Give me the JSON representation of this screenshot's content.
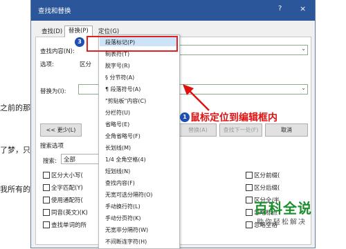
{
  "background_text": [
    "之前的那个",
    "了梦，只要",
    "我所有的"
  ],
  "dialog": {
    "title": "查找和替换",
    "help": "?",
    "close": "×",
    "tabs": [
      "查找(D)",
      "替换(P)",
      "定位(G)"
    ],
    "find_label": "查找内容(N):",
    "options_label": "选项:",
    "options_value": "区分",
    "replace_label": "替换为(I):",
    "less_button": "<< 更少(L)",
    "replace_all_button": "替换(A)",
    "find_next_button": "查找下一处(F)",
    "cancel_button": "取消",
    "search_options_label": "搜索选项",
    "search_label": "搜索:",
    "search_value": "全部",
    "left_checkboxes": [
      "区分大小写(",
      "全字匹配(Y)",
      "使用通配符(",
      "同音(英文)(K)",
      "查找单词的所"
    ],
    "right_checkboxes": [
      "区分前缀(",
      "区分后缀(",
      "区分全/半",
      "忽略标点",
      "忽略空格"
    ]
  },
  "dropdown": {
    "items": [
      "段落标记(P)",
      "制表符(T)",
      "脱字号(R)",
      "§ 分节符(A)",
      "¶ 段落符号(A)",
      "\"剪贴板\"内容(C)",
      "分栏符(U)",
      "省略号(E)",
      "全角省略号(F)",
      "长划线(M)",
      "1/4 全角空格(4)",
      "短划线(N)",
      "查找内容(F)",
      "无宽可选分隔符(O)",
      "手动换行符(L)",
      "手动分页符(K)",
      "无宽非分隔符(W)",
      "不间断连字符(H)"
    ],
    "selected_index": 0
  },
  "annotations": {
    "step_3": "3",
    "step_1": "1",
    "callout": "鼠标定位到编辑框内",
    "accent": "#e01010"
  },
  "watermark": {
    "title": "百科全说",
    "subtitle": "助你轻松解决"
  }
}
